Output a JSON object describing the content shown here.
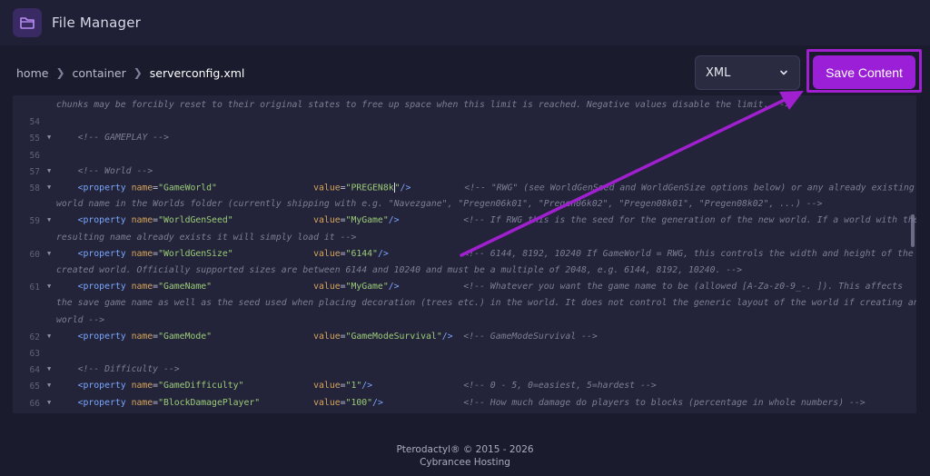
{
  "app": {
    "title": "File Manager"
  },
  "breadcrumb": {
    "items": [
      "home",
      "container"
    ],
    "current": "serverconfig.xml"
  },
  "toolbar": {
    "language": "XML",
    "save_label": "Save Content"
  },
  "editor": {
    "lines": [
      {
        "ln": "",
        "fold": false,
        "parts": [
          {
            "t": "c-comment",
            "v": "chunks may be forcibly reset to their original states to free up space when this limit is reached. Negative values disable the limit. -->"
          }
        ]
      },
      {
        "ln": "54",
        "fold": false,
        "parts": []
      },
      {
        "ln": "55",
        "fold": true,
        "parts": [
          {
            "t": "c-comment",
            "v": "    <!-- GAMEPLAY -->"
          }
        ]
      },
      {
        "ln": "56",
        "fold": false,
        "parts": []
      },
      {
        "ln": "57",
        "fold": true,
        "parts": [
          {
            "t": "c-comment",
            "v": "    <!-- World -->"
          }
        ]
      },
      {
        "ln": "58",
        "fold": true,
        "parts": [
          {
            "t": "c-tag",
            "v": "    <property "
          },
          {
            "t": "c-attr",
            "v": "name"
          },
          {
            "t": "c-eq",
            "v": "="
          },
          {
            "t": "c-str",
            "v": "\"GameWorld\""
          },
          {
            "t": "c-eq",
            "v": "                  "
          },
          {
            "t": "c-attr",
            "v": "value"
          },
          {
            "t": "c-eq",
            "v": "="
          },
          {
            "t": "c-str",
            "v": "\"PREGEN8k"
          },
          {
            "t": "cursor",
            "v": ""
          },
          {
            "t": "c-str",
            "v": "\""
          },
          {
            "t": "c-tag",
            "v": "/>"
          },
          {
            "t": "c-comment",
            "v": "          <!-- \"RWG\" (see WorldGenSeed and WorldGenSize options below) or any already existing"
          }
        ]
      },
      {
        "ln": "",
        "fold": false,
        "parts": [
          {
            "t": "c-comment",
            "v": "world name in the Worlds folder (currently shipping with e.g. \"Navezgane\", \"Pregen06k01\", \"Pregen06k02\", \"Pregen08k01\", \"Pregen08k02\", ...) -->"
          }
        ]
      },
      {
        "ln": "59",
        "fold": true,
        "parts": [
          {
            "t": "c-tag",
            "v": "    <property "
          },
          {
            "t": "c-attr",
            "v": "name"
          },
          {
            "t": "c-eq",
            "v": "="
          },
          {
            "t": "c-str",
            "v": "\"WorldGenSeed\""
          },
          {
            "t": "c-eq",
            "v": "               "
          },
          {
            "t": "c-attr",
            "v": "value"
          },
          {
            "t": "c-eq",
            "v": "="
          },
          {
            "t": "c-str",
            "v": "\"MyGame\""
          },
          {
            "t": "c-tag",
            "v": "/>"
          },
          {
            "t": "c-comment",
            "v": "            <!-- If RWG this is the seed for the generation of the new world. If a world with the"
          }
        ]
      },
      {
        "ln": "",
        "fold": false,
        "parts": [
          {
            "t": "c-comment",
            "v": "resulting name already exists it will simply load it -->"
          }
        ]
      },
      {
        "ln": "60",
        "fold": true,
        "parts": [
          {
            "t": "c-tag",
            "v": "    <property "
          },
          {
            "t": "c-attr",
            "v": "name"
          },
          {
            "t": "c-eq",
            "v": "="
          },
          {
            "t": "c-str",
            "v": "\"WorldGenSize\""
          },
          {
            "t": "c-eq",
            "v": "               "
          },
          {
            "t": "c-attr",
            "v": "value"
          },
          {
            "t": "c-eq",
            "v": "="
          },
          {
            "t": "c-str",
            "v": "\"6144\""
          },
          {
            "t": "c-tag",
            "v": "/>"
          },
          {
            "t": "c-comment",
            "v": "              <!-- 6144, 8192, 10240 If GameWorld = RWG, this controls the width and height of the"
          }
        ]
      },
      {
        "ln": "",
        "fold": false,
        "parts": [
          {
            "t": "c-comment",
            "v": "created world. Officially supported sizes are between 6144 and 10240 and must be a multiple of 2048, e.g. 6144, 8192, 10240. -->"
          }
        ]
      },
      {
        "ln": "61",
        "fold": true,
        "parts": [
          {
            "t": "c-tag",
            "v": "    <property "
          },
          {
            "t": "c-attr",
            "v": "name"
          },
          {
            "t": "c-eq",
            "v": "="
          },
          {
            "t": "c-str",
            "v": "\"GameName\""
          },
          {
            "t": "c-eq",
            "v": "                   "
          },
          {
            "t": "c-attr",
            "v": "value"
          },
          {
            "t": "c-eq",
            "v": "="
          },
          {
            "t": "c-str",
            "v": "\"MyGame\""
          },
          {
            "t": "c-tag",
            "v": "/>"
          },
          {
            "t": "c-comment",
            "v": "            <!-- Whatever you want the game name to be (allowed [A-Za-z0-9_-. ]). This affects"
          }
        ]
      },
      {
        "ln": "",
        "fold": false,
        "parts": [
          {
            "t": "c-comment",
            "v": "the save game name as well as the seed used when placing decoration (trees etc.) in the world. It does not control the generic layout of the world if creating an RWG"
          }
        ]
      },
      {
        "ln": "",
        "fold": false,
        "parts": [
          {
            "t": "c-comment",
            "v": "world -->"
          }
        ]
      },
      {
        "ln": "62",
        "fold": true,
        "parts": [
          {
            "t": "c-tag",
            "v": "    <property "
          },
          {
            "t": "c-attr",
            "v": "name"
          },
          {
            "t": "c-eq",
            "v": "="
          },
          {
            "t": "c-str",
            "v": "\"GameMode\""
          },
          {
            "t": "c-eq",
            "v": "                   "
          },
          {
            "t": "c-attr",
            "v": "value"
          },
          {
            "t": "c-eq",
            "v": "="
          },
          {
            "t": "c-str",
            "v": "\"GameModeSurvival\""
          },
          {
            "t": "c-tag",
            "v": "/>"
          },
          {
            "t": "c-comment",
            "v": "  <!-- GameModeSurvival -->"
          }
        ]
      },
      {
        "ln": "63",
        "fold": false,
        "parts": []
      },
      {
        "ln": "64",
        "fold": true,
        "parts": [
          {
            "t": "c-comment",
            "v": "    <!-- Difficulty -->"
          }
        ]
      },
      {
        "ln": "65",
        "fold": true,
        "parts": [
          {
            "t": "c-tag",
            "v": "    <property "
          },
          {
            "t": "c-attr",
            "v": "name"
          },
          {
            "t": "c-eq",
            "v": "="
          },
          {
            "t": "c-str",
            "v": "\"GameDifficulty\""
          },
          {
            "t": "c-eq",
            "v": "             "
          },
          {
            "t": "c-attr",
            "v": "value"
          },
          {
            "t": "c-eq",
            "v": "="
          },
          {
            "t": "c-str",
            "v": "\"1\""
          },
          {
            "t": "c-tag",
            "v": "/>"
          },
          {
            "t": "c-comment",
            "v": "                 <!-- 0 - 5, 0=easiest, 5=hardest -->"
          }
        ]
      },
      {
        "ln": "66",
        "fold": true,
        "parts": [
          {
            "t": "c-tag",
            "v": "    <property "
          },
          {
            "t": "c-attr",
            "v": "name"
          },
          {
            "t": "c-eq",
            "v": "="
          },
          {
            "t": "c-str",
            "v": "\"BlockDamagePlayer\""
          },
          {
            "t": "c-eq",
            "v": "          "
          },
          {
            "t": "c-attr",
            "v": "value"
          },
          {
            "t": "c-eq",
            "v": "="
          },
          {
            "t": "c-str",
            "v": "\"100\""
          },
          {
            "t": "c-tag",
            "v": "/>"
          },
          {
            "t": "c-comment",
            "v": "               <!-- How much damage do players to blocks (percentage in whole numbers) -->"
          }
        ]
      }
    ]
  },
  "footer": {
    "line1": "Pterodactyl® © 2015 - 2026",
    "line2": "Cybrancee Hosting"
  },
  "colors": {
    "accent": "#9b1fd6",
    "annotation": "#a020d0",
    "background": "#1b1b2e"
  }
}
